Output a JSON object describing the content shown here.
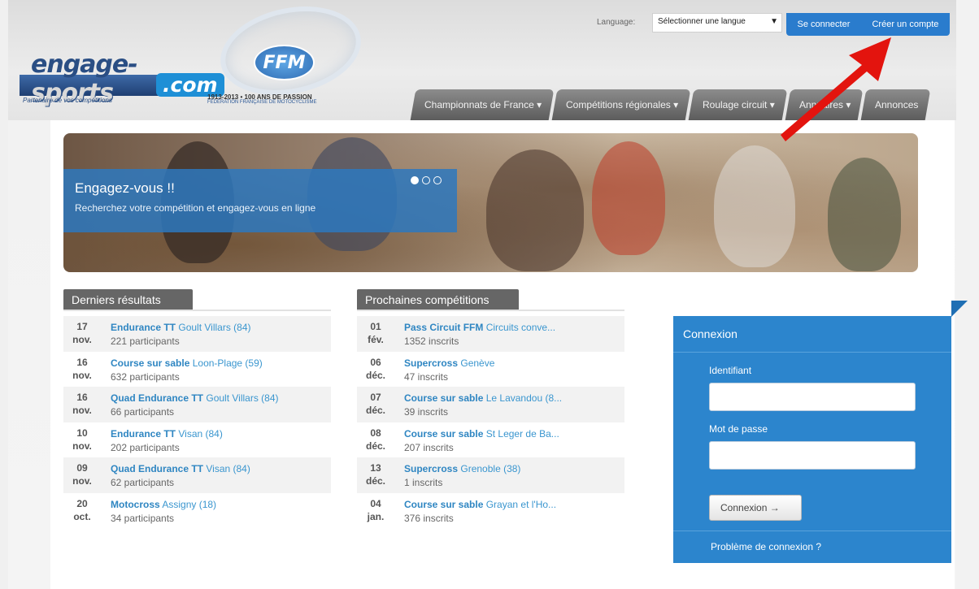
{
  "header": {
    "logo": {
      "brand_main": "engage-",
      "brand_accent": "sports",
      "brand_tld": ".com",
      "tagline": "Partenaire de vos compétitions"
    },
    "ffm": {
      "badge": "FFM",
      "anniversary": "1913-2013 • 100 ANS DE PASSION",
      "federation": "FÉDÉRATION FRANÇAISE DE MOTOCYCLISME"
    },
    "language_label": "Language:",
    "language_select": "Sélectionner une langue",
    "login_link": "Se connecter",
    "signup_link": "Créer un compte",
    "nav": [
      {
        "label": "Championnats de France ▾"
      },
      {
        "label": "Compétitions régionales ▾"
      },
      {
        "label": "Roulage circuit ▾"
      },
      {
        "label": "Annuaires ▾"
      },
      {
        "label": "Annonces"
      }
    ]
  },
  "hero": {
    "title": "Engagez-vous !!",
    "subtitle": "Recherchez votre compétition et engagez-vous en ligne",
    "slides": 3,
    "active_slide": 1
  },
  "results": {
    "title": "Derniers résultats",
    "rows": [
      {
        "day": "17",
        "month": "nov.",
        "category": "Endurance TT",
        "place": "Goult Villars (84)",
        "count": "221 participants"
      },
      {
        "day": "16",
        "month": "nov.",
        "category": "Course sur sable",
        "place": "Loon-Plage (59)",
        "count": "632 participants"
      },
      {
        "day": "16",
        "month": "nov.",
        "category": "Quad Endurance TT",
        "place": "Goult Villars (84)",
        "count": "66 participants"
      },
      {
        "day": "10",
        "month": "nov.",
        "category": "Endurance TT",
        "place": "Visan (84)",
        "count": "202 participants"
      },
      {
        "day": "09",
        "month": "nov.",
        "category": "Quad Endurance TT",
        "place": "Visan (84)",
        "count": "62 participants"
      },
      {
        "day": "20",
        "month": "oct.",
        "category": "Motocross",
        "place": "Assigny (18)",
        "count": "34 participants"
      }
    ]
  },
  "upcoming": {
    "title": "Prochaines compétitions",
    "rows": [
      {
        "day": "01",
        "month": "fév.",
        "category": "Pass Circuit FFM",
        "place": "Circuits conve...",
        "count": "1352 inscrits"
      },
      {
        "day": "06",
        "month": "déc.",
        "category": "Supercross",
        "place": "Genève",
        "count": "47 inscrits"
      },
      {
        "day": "07",
        "month": "déc.",
        "category": "Course sur sable",
        "place": "Le Lavandou (8...",
        "count": "39 inscrits"
      },
      {
        "day": "08",
        "month": "déc.",
        "category": "Course sur sable",
        "place": "St Leger de Ba...",
        "count": "207 inscrits"
      },
      {
        "day": "13",
        "month": "déc.",
        "category": "Supercross",
        "place": "Grenoble (38)",
        "count": "1 inscrits"
      },
      {
        "day": "04",
        "month": "jan.",
        "category": "Course sur sable",
        "place": "Grayan et l'Ho...",
        "count": "376 inscrits"
      }
    ]
  },
  "login": {
    "title": "Connexion",
    "username_label": "Identifiant",
    "password_label": "Mot de passe",
    "submit": "Connexion →",
    "forgot": "Problème de connexion ?"
  },
  "colors": {
    "accent": "#2a7ccd",
    "panel": "#2c85cd",
    "arrow": "#e3140e",
    "link": "#3a96cf"
  }
}
